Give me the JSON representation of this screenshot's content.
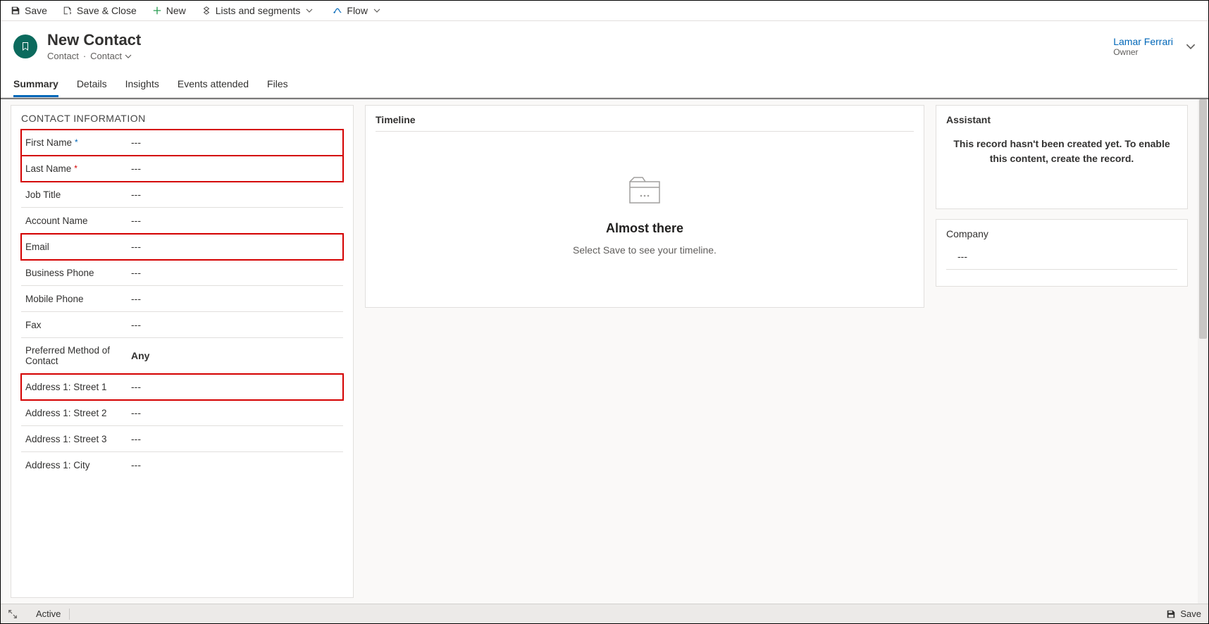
{
  "commandbar": {
    "save": "Save",
    "save_close": "Save & Close",
    "new": "New",
    "lists": "Lists and segments",
    "flow": "Flow"
  },
  "header": {
    "title": "New Contact",
    "entity": "Contact",
    "formname": "Contact",
    "owner_name": "Lamar Ferrari",
    "owner_role": "Owner"
  },
  "tabs": [
    "Summary",
    "Details",
    "Insights",
    "Events attended",
    "Files"
  ],
  "active_tab": 0,
  "contact_info": {
    "section_title": "CONTACT INFORMATION",
    "fields": [
      {
        "label": "First Name",
        "value": "---",
        "required": "blue",
        "highlight": true
      },
      {
        "label": "Last Name",
        "value": "---",
        "required": "red",
        "highlight": true
      },
      {
        "label": "Job Title",
        "value": "---"
      },
      {
        "label": "Account Name",
        "value": "---"
      },
      {
        "label": "Email",
        "value": "---",
        "highlight": true
      },
      {
        "label": "Business Phone",
        "value": "---"
      },
      {
        "label": "Mobile Phone",
        "value": "---"
      },
      {
        "label": "Fax",
        "value": "---"
      },
      {
        "label": "Preferred Method of Contact",
        "value": "Any",
        "bold": true
      },
      {
        "label": "Address 1: Street 1",
        "value": "---",
        "highlight": true
      },
      {
        "label": "Address 1: Street 2",
        "value": "---"
      },
      {
        "label": "Address 1: Street 3",
        "value": "---"
      },
      {
        "label": "Address 1: City",
        "value": "---"
      }
    ]
  },
  "timeline": {
    "title": "Timeline",
    "heading": "Almost there",
    "message": "Select Save to see your timeline."
  },
  "assistant": {
    "title": "Assistant",
    "message": "This record hasn't been created yet. To enable this content, create the record."
  },
  "company": {
    "label": "Company",
    "value": "---"
  },
  "statusbar": {
    "status": "Active",
    "save": "Save"
  }
}
